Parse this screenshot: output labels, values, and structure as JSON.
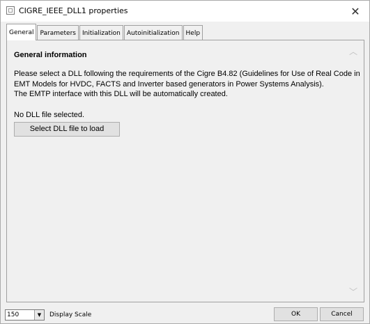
{
  "window": {
    "title": "CIGRE_IEEE_DLL1 properties",
    "close_glyph": "✕"
  },
  "tabs": [
    {
      "label": "General",
      "active": true
    },
    {
      "label": "Parameters",
      "active": false
    },
    {
      "label": "Initialization",
      "active": false
    },
    {
      "label": "Autoinitialization",
      "active": false
    },
    {
      "label": "Help",
      "active": false
    }
  ],
  "general": {
    "heading": "General information",
    "description_lines": [
      "Please select a DLL following the requirements of the Cigre B4.82 (Guidelines for Use of Real Code in",
      "EMT Models for HVDC, FACTS and Inverter based generators in Power Systems Analysis).",
      "The EMTP interface with this DLL will be automatically created."
    ],
    "status": "No DLL file selected.",
    "select_button": "Select DLL file to load"
  },
  "footer": {
    "scale_value": "150",
    "scale_label": "Display Scale",
    "ok_label": "OK",
    "cancel_label": "Cancel"
  },
  "icons": {
    "app": "window-icon",
    "close": "close-icon",
    "scroll_up": "chevron-up-icon",
    "scroll_down": "chevron-down-icon",
    "dropdown": "dropdown-arrow-icon"
  }
}
